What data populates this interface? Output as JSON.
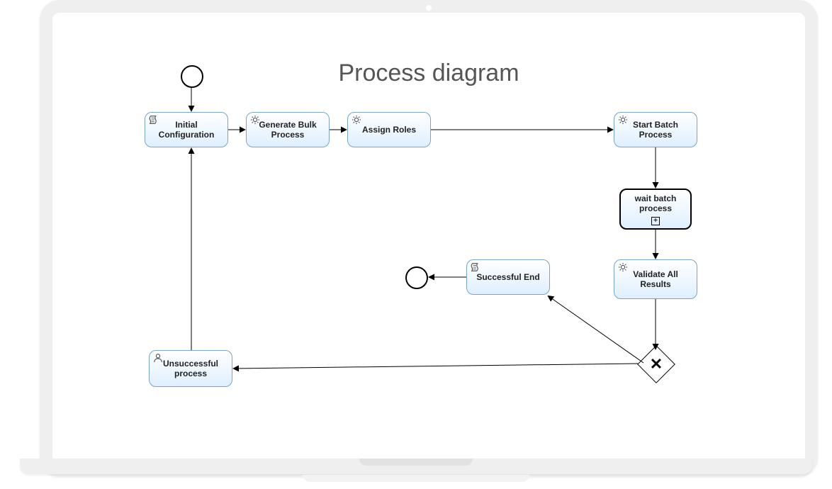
{
  "title": "Process diagram",
  "nodes": {
    "initial": {
      "label": "Initial Configuration",
      "icon": "script"
    },
    "generate": {
      "label": "Generate Bulk Process",
      "icon": "service"
    },
    "roles": {
      "label": "Assign Roles",
      "icon": "service"
    },
    "start": {
      "label": "Start Batch Process",
      "icon": "service"
    },
    "wait": {
      "label": "wait batch process",
      "icon": "none",
      "subprocess": true
    },
    "validate": {
      "label": "Validate All Results",
      "icon": "service"
    },
    "success": {
      "label": "Successful End",
      "icon": "script"
    },
    "unsuccess": {
      "label": "Unsuccessful process",
      "icon": "user"
    }
  },
  "gateway": {
    "type": "exclusive"
  },
  "events": {
    "start": "start-event",
    "end": "end-event"
  },
  "flows": [
    [
      "start-event",
      "initial"
    ],
    [
      "initial",
      "generate"
    ],
    [
      "generate",
      "roles"
    ],
    [
      "roles",
      "start"
    ],
    [
      "start",
      "wait"
    ],
    [
      "wait",
      "validate"
    ],
    [
      "validate",
      "gateway"
    ],
    [
      "gateway",
      "success"
    ],
    [
      "gateway",
      "unsuccess"
    ],
    [
      "success",
      "end-event"
    ],
    [
      "unsuccess",
      "initial"
    ]
  ]
}
